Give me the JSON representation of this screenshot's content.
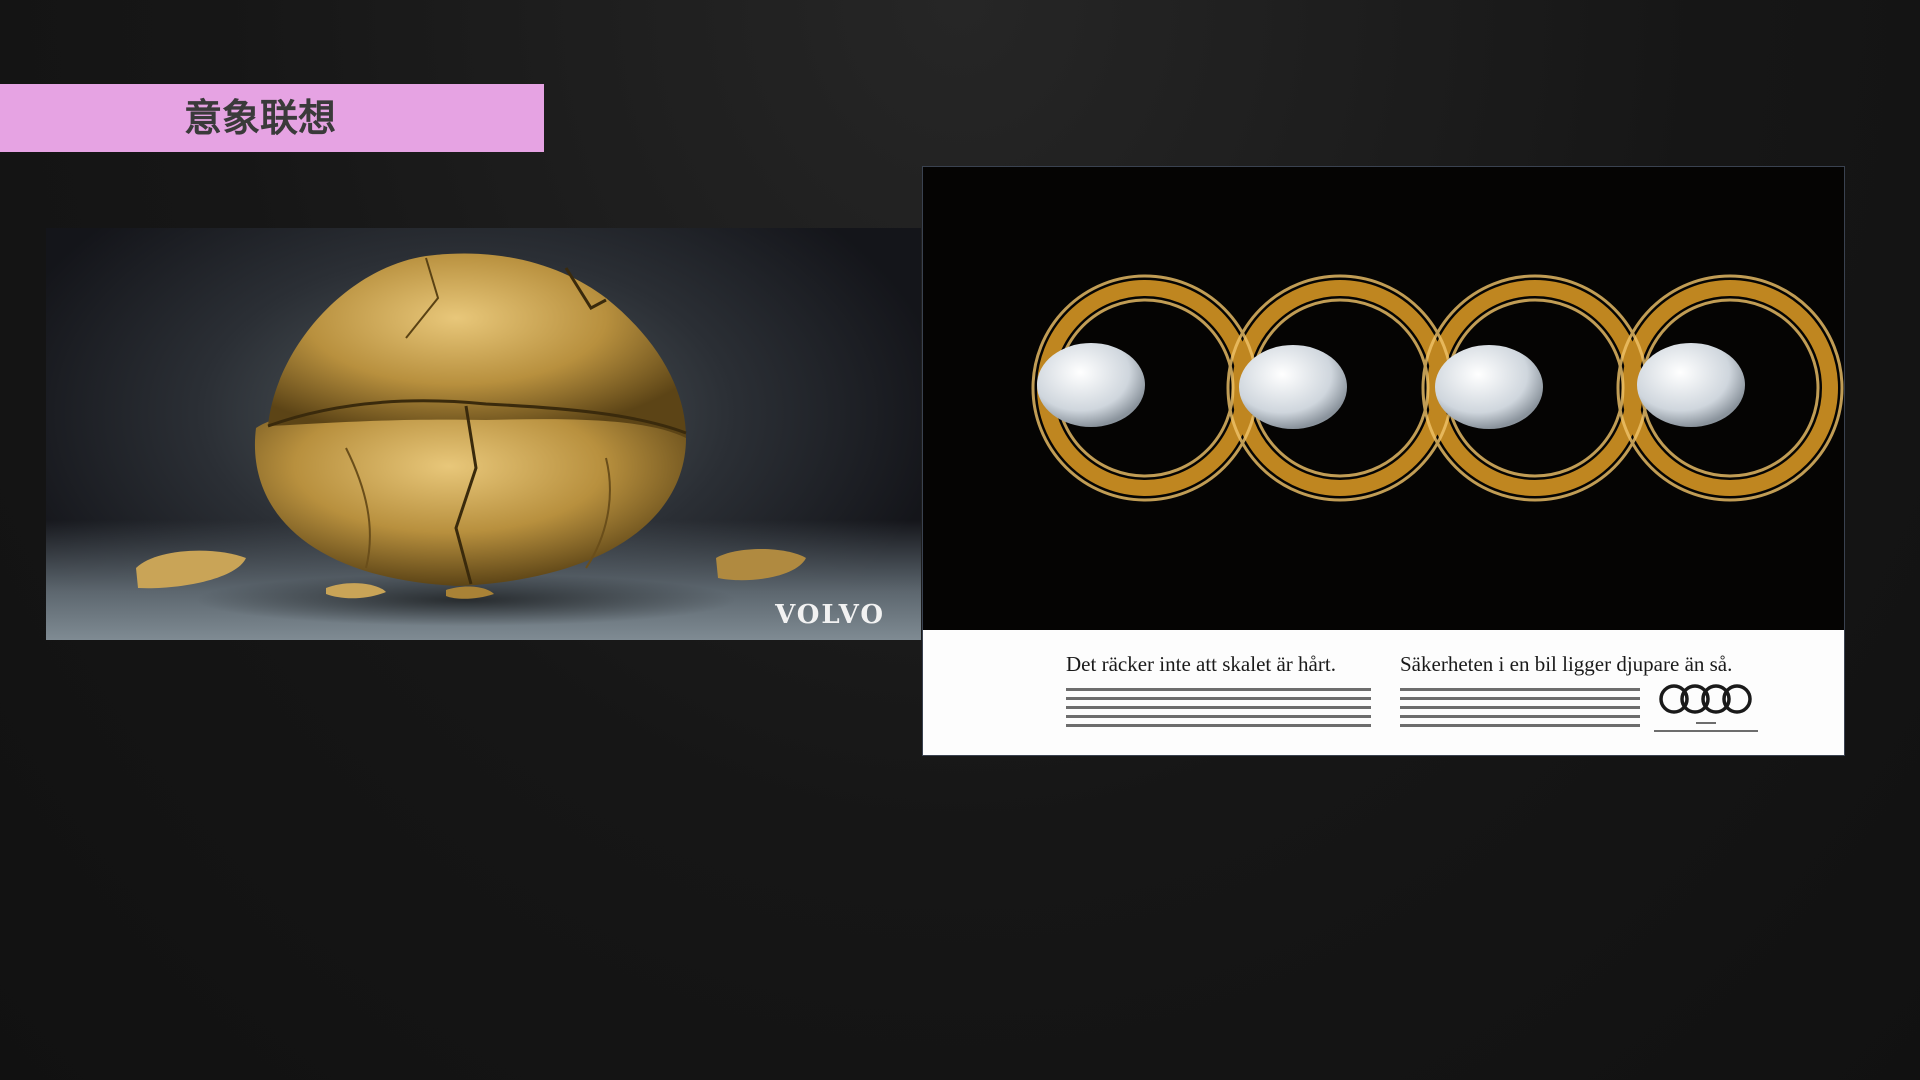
{
  "slide": {
    "title": "意象联想"
  },
  "images": {
    "left": {
      "subject": "cracked-walnut",
      "brand_text": "VOLVO"
    },
    "right": {
      "subject": "four-nests-with-eggs",
      "headline_left": "Det räcker inte att skalet är hårt.",
      "headline_right": "Säkerheten i en bil ligger djupare än så.",
      "logo": "audi-rings-logo"
    }
  },
  "colors": {
    "title_bar": "#e6a3e3",
    "background": "#161616"
  }
}
